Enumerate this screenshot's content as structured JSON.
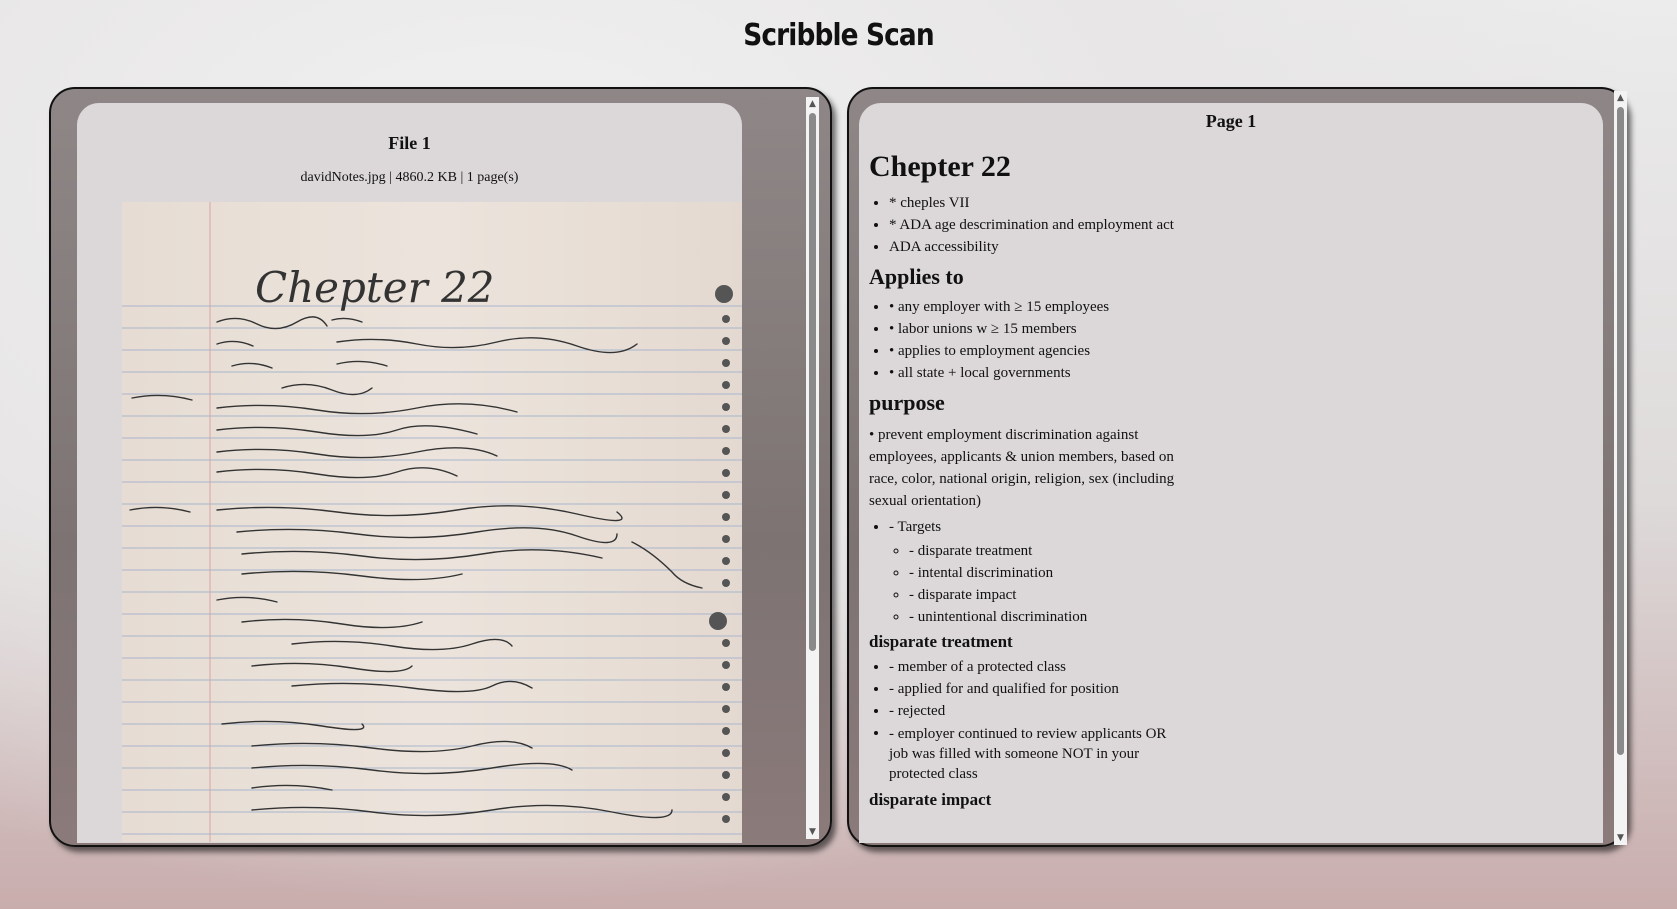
{
  "app": {
    "title": "Scribble Scan"
  },
  "files_panel": {
    "file_title": "File 1",
    "file_meta": "davidNotes.jpg | 4860.2 KB | 1 page(s)",
    "image_label": "Chepter 22"
  },
  "scroll_arrows": {
    "up": "▲",
    "down": "▼"
  },
  "doc_panel": {
    "page_title": "Page 1",
    "heading": "Chepter 22",
    "intro_items": [
      "* cheples VII",
      "* ADA age descrimination and employment act",
      "ADA accessibility"
    ],
    "applies_heading": "Applies to",
    "applies_items": [
      "• any employer with ≥ 15 employees",
      "• labor unions w ≥ 15 members",
      "• applies to employment agencies",
      "• all state + local governments"
    ],
    "purpose_heading": "purpose",
    "purpose_text": "• prevent employment discrimination against employees, applicants & union members, based on race, color, national origin, religion, sex (including sexual orientation)",
    "targets_label": "- Targets",
    "targets_items": [
      "- disparate treatment",
      "- intental discrimination",
      "- disparate impact",
      "- unintentional discrimination"
    ],
    "disparate_treatment_heading": "disparate treatment",
    "disparate_treatment_items": [
      "- member of a protected class",
      "- applied for and qualified for position",
      "- rejected",
      "- employer continued to review applicants OR job was filled with someone NOT in your protected class"
    ],
    "disparate_impact_heading": "disparate impact"
  }
}
